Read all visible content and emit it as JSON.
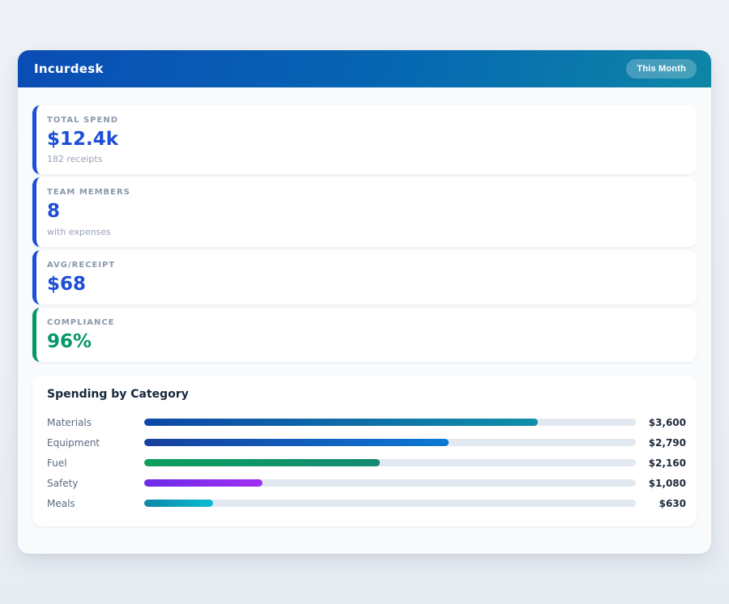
{
  "header": {
    "title": "Incurdesk",
    "badge": "This Month"
  },
  "theme": {
    "header_gradient_from": "#0a4cb5",
    "header_gradient_to": "#0e86a6",
    "accent_blue": "#1d4ed8",
    "accent_green": "#059669",
    "track_color": "#e2e8f0",
    "value_text": "#1e293b"
  },
  "stats": [
    {
      "label": "TOTAL SPEND",
      "value": "$12.4k",
      "sub": "182 receipts",
      "accent": "#1d4ed8",
      "value_color": "#1d4ed8"
    },
    {
      "label": "TEAM MEMBERS",
      "value": "8",
      "sub": "with expenses",
      "accent": "#1d4ed8",
      "value_color": "#1d4ed8"
    },
    {
      "label": "AVG/RECEIPT",
      "value": "$68",
      "sub": "",
      "accent": "#1d4ed8",
      "value_color": "#1d4ed8"
    },
    {
      "label": "COMPLIANCE",
      "value": "96%",
      "sub": "",
      "accent": "#059669",
      "value_color": "#059669"
    }
  ],
  "chart_data": {
    "type": "bar",
    "title": "Spending by Category",
    "orientation": "horizontal",
    "categories": [
      "Materials",
      "Equipment",
      "Fuel",
      "Safety",
      "Meals"
    ],
    "values": [
      3600,
      2790,
      2160,
      1080,
      630
    ],
    "value_labels": [
      "$3,600",
      "$2,790",
      "$2,160",
      "$1,080",
      "$630"
    ],
    "max_fill_pct": 80,
    "rows": [
      {
        "label": "Materials",
        "value_label": "$3,600",
        "amount": 3600,
        "pct": 80,
        "color_from": "#0d47a8",
        "color_to": "#0e8fa8"
      },
      {
        "label": "Equipment",
        "value_label": "$2,790",
        "amount": 2790,
        "pct": 62,
        "color_from": "#17409f",
        "color_to": "#0b79d4"
      },
      {
        "label": "Fuel",
        "value_label": "$2,160",
        "amount": 2160,
        "pct": 48,
        "color_from": "#0aa05c",
        "color_to": "#158a74"
      },
      {
        "label": "Safety",
        "value_label": "$1,080",
        "amount": 1080,
        "pct": 24,
        "color_from": "#6d2ce8",
        "color_to": "#a02ff2"
      },
      {
        "label": "Meals",
        "value_label": "$630",
        "amount": 630,
        "pct": 14,
        "color_from": "#0e86a6",
        "color_to": "#0bbcd4"
      }
    ]
  }
}
